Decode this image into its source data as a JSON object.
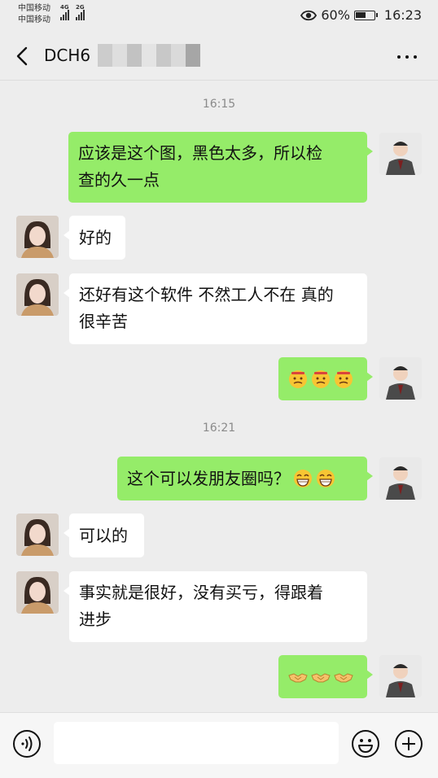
{
  "status_bar": {
    "carrier1": "中国移动",
    "carrier2": "中国移动",
    "net1": "4G",
    "net2": "2G",
    "battery_text": "60%",
    "battery_level": 0.6,
    "time": "16:23"
  },
  "nav": {
    "title": "DCH6",
    "back_icon": "chevron-left-icon",
    "more_icon": "more-dots-icon"
  },
  "chat": {
    "timestamps": [
      "16:15",
      "16:21"
    ],
    "messages": [
      {
        "sender": "me",
        "lines": [
          "应该是这个图，黑色太多，所以检",
          "查的久一点"
        ]
      },
      {
        "sender": "her",
        "lines": [
          "好的"
        ]
      },
      {
        "sender": "her",
        "lines": [
          "还好有这个软件 不然工人不在 真的",
          "很辛苦"
        ]
      },
      {
        "sender": "me",
        "emoji": "bruised-face-emoji",
        "emoji_count": 3
      },
      {
        "sender": "me",
        "lines": [
          "这个可以发朋友圈吗？"
        ],
        "emoji": "grin-emoji",
        "emoji_count": 2
      },
      {
        "sender": "her",
        "lines": [
          "可以的"
        ]
      },
      {
        "sender": "her",
        "lines": [
          "事实就是很好，没有买亏，得跟着",
          "进步"
        ]
      },
      {
        "sender": "me",
        "emoji": "handshake-emoji",
        "emoji_count": 3
      }
    ]
  },
  "input_bar": {
    "placeholder": "",
    "voice_icon": "voice-icon",
    "emoji_icon": "smiley-icon",
    "plus_icon": "plus-icon"
  },
  "colors": {
    "background": "#ededed",
    "my_bubble": "#95ec69",
    "her_bubble": "#ffffff"
  }
}
